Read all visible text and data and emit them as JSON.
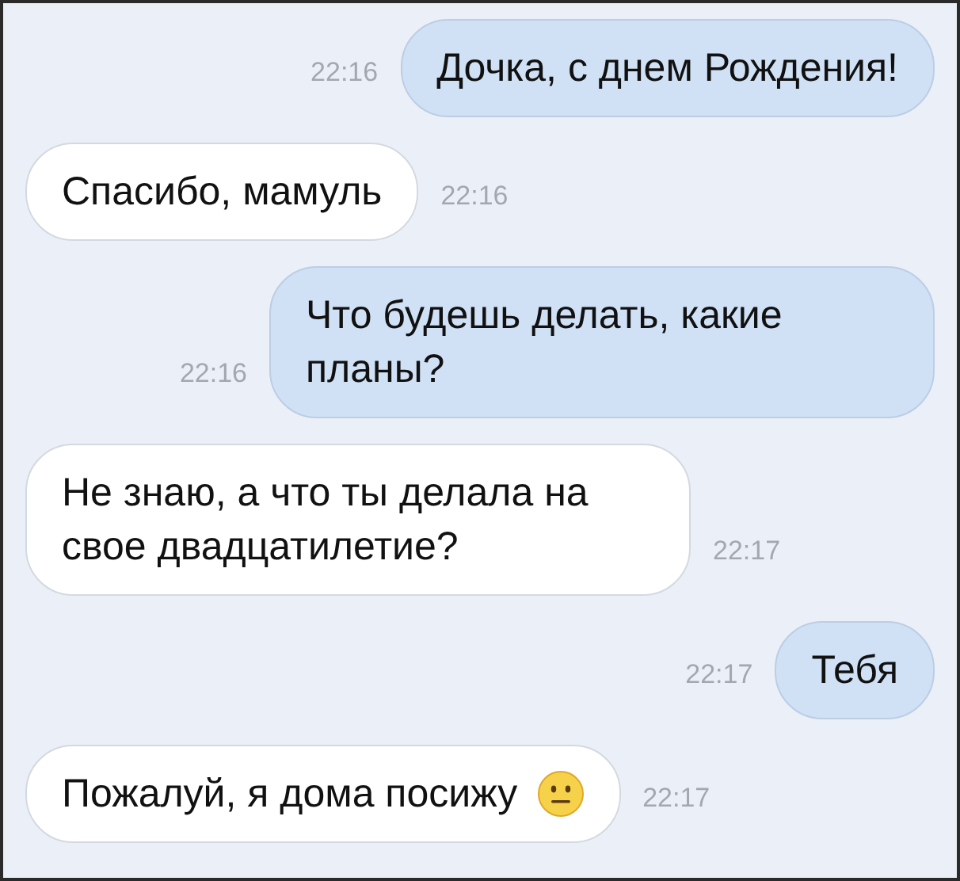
{
  "messages": [
    {
      "kind": "outgoing",
      "text": "Дочка, с днем Рождения!",
      "time": "22:16"
    },
    {
      "kind": "incoming",
      "text": "Спасибо, мамуль",
      "time": "22:16"
    },
    {
      "kind": "outgoing",
      "text": "Что будешь делать, какие планы?",
      "time": "22:16"
    },
    {
      "kind": "incoming",
      "text": "Не знаю, а что ты делала на свое двадцатилетие?",
      "time": "22:17"
    },
    {
      "kind": "outgoing",
      "text": "Тебя",
      "time": "22:17"
    },
    {
      "kind": "incoming",
      "text": "Пожалуй, я дома посижу",
      "time": "22:17",
      "emoji": true
    }
  ]
}
